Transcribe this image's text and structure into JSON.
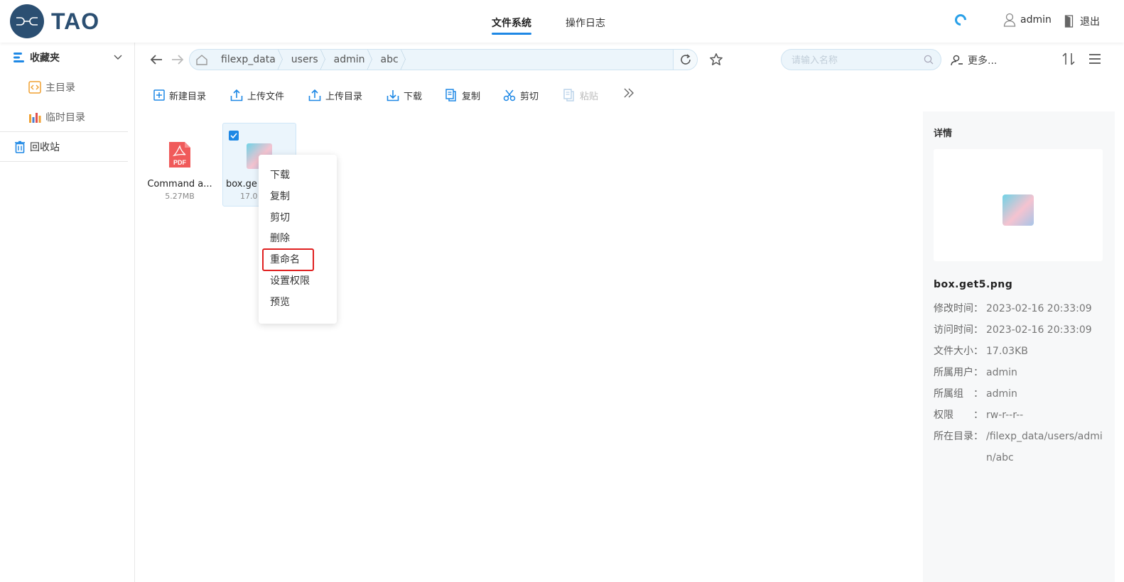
{
  "header": {
    "logo_text": "TAO",
    "tabs": [
      {
        "label": "文件系统",
        "active": true
      },
      {
        "label": "操作日志",
        "active": false
      }
    ],
    "user_name": "admin",
    "logout_label": "退出"
  },
  "sidebar": {
    "favorites_label": "收藏夹",
    "items": [
      {
        "label": "主目录"
      },
      {
        "label": "临时目录"
      }
    ],
    "recycle_label": "回收站"
  },
  "breadcrumb": [
    "filexp_data",
    "users",
    "admin",
    "abc"
  ],
  "search": {
    "placeholder": "请输入名称"
  },
  "more_label": "更多...",
  "toolbar": {
    "new_dir": "新建目录",
    "upload_file": "上传文件",
    "upload_dir": "上传目录",
    "download": "下载",
    "copy": "复制",
    "cut": "剪切",
    "paste": "粘贴"
  },
  "files": [
    {
      "name": "Command a...",
      "size": "5.27MB",
      "type": "pdf",
      "selected": false
    },
    {
      "name": "box.ge",
      "size": "17.0",
      "type": "png",
      "selected": true
    }
  ],
  "context_menu": [
    "下载",
    "复制",
    "剪切",
    "删除",
    "重命名",
    "设置权限",
    "预览"
  ],
  "details": {
    "title": "详情",
    "filename": "box.get5.png",
    "rows": [
      {
        "label": "修改时间：",
        "value": "2023-02-16 20:33:09"
      },
      {
        "label": "访问时间：",
        "value": "2023-02-16 20:33:09"
      },
      {
        "label": "文件大小：",
        "value": "17.03KB"
      },
      {
        "label": "所属用户：",
        "value": "admin"
      },
      {
        "label": "所属组　：",
        "value": "admin"
      },
      {
        "label": "权限　　：",
        "value": "rw-r--r--"
      },
      {
        "label": "所在目录：",
        "value": "/filexp_data/users/admin/abc"
      }
    ]
  },
  "colors": {
    "accent": "#1e88e5",
    "brand": "#2b4f72",
    "highlight": "#e02020"
  }
}
